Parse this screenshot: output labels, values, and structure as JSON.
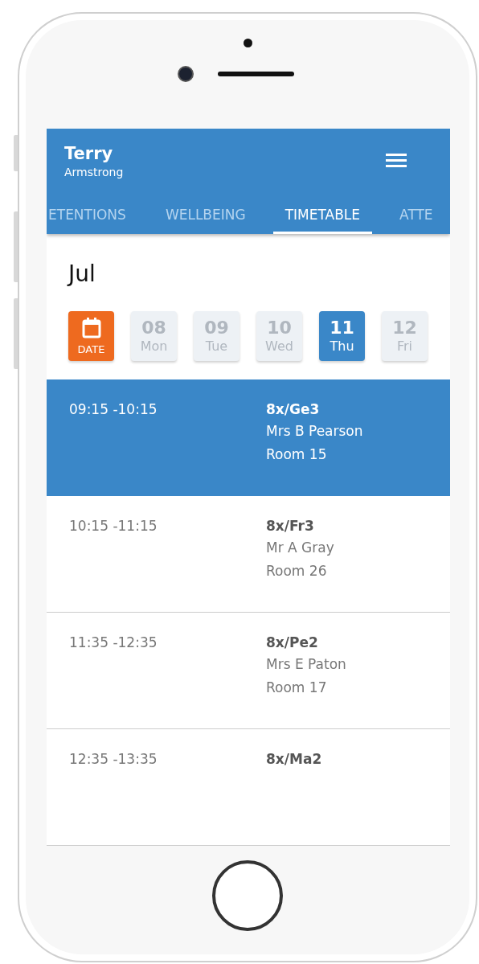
{
  "header": {
    "first_name": "Terry",
    "last_name": "Armstrong"
  },
  "tabs": [
    {
      "label": "ETENTIONS",
      "selected": false
    },
    {
      "label": "WELLBEING",
      "selected": false
    },
    {
      "label": "TIMETABLE",
      "selected": true
    },
    {
      "label": "ATTE",
      "selected": false
    }
  ],
  "month": "Jul",
  "days": [
    {
      "kind": "date",
      "label": "DATE",
      "selected": false
    },
    {
      "kind": "day",
      "number": "08",
      "weekday": "Mon",
      "selected": false
    },
    {
      "kind": "day",
      "number": "09",
      "weekday": "Tue",
      "selected": false
    },
    {
      "kind": "day",
      "number": "10",
      "weekday": "Wed",
      "selected": false
    },
    {
      "kind": "day",
      "number": "11",
      "weekday": "Thu",
      "selected": true
    },
    {
      "kind": "day",
      "number": "12",
      "weekday": "Fri",
      "selected": false
    }
  ],
  "lessons": [
    {
      "time": "09:15 -10:15",
      "class": "8x/Ge3",
      "teacher": "Mrs B Pearson",
      "room": "Room 15",
      "selected": true
    },
    {
      "time": "10:15 -11:15",
      "class": "8x/Fr3",
      "teacher": "Mr A Gray",
      "room": "Room 26",
      "selected": false
    },
    {
      "time": "11:35 -12:35",
      "class": "8x/Pe2",
      "teacher": "Mrs E Paton",
      "room": "Room 17",
      "selected": false
    },
    {
      "time": "12:35 -13:35",
      "class": "8x/Ma2",
      "selected": false
    }
  ]
}
